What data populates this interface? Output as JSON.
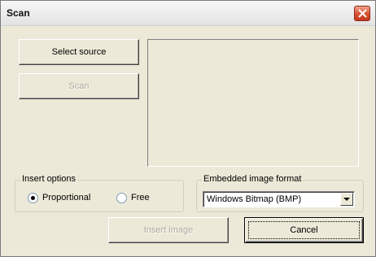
{
  "window": {
    "title": "Scan",
    "close_icon": "close-icon"
  },
  "buttons": {
    "select_source": "Select source",
    "scan": "Scan",
    "insert_image": "Insert image",
    "cancel": "Cancel"
  },
  "insert_options": {
    "label": "Insert options",
    "options": [
      {
        "label": "Proportional",
        "selected": true
      },
      {
        "label": "Free",
        "selected": false
      }
    ]
  },
  "format": {
    "label": "Embedded image format",
    "selected": "Windows Bitmap (BMP)"
  },
  "colors": {
    "face": "#ece9d8",
    "close_button": "#d9502f",
    "disabled_text": "#aca899"
  }
}
